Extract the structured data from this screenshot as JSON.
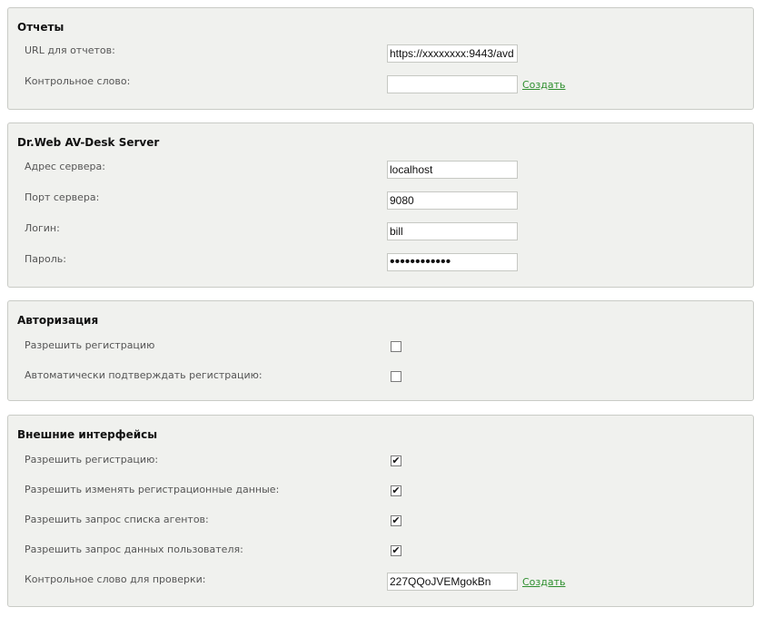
{
  "reports": {
    "title": "Отчеты",
    "url_label": "URL для отчетов:",
    "url_value": "https://xxxxxxxx:9443/avd",
    "secret_label": "Контрольное слово:",
    "secret_value": "",
    "create_link": "Создать"
  },
  "server": {
    "title": "Dr.Web AV-Desk Server",
    "address_label": "Адрес сервера:",
    "address_value": "localhost",
    "port_label": "Порт сервера:",
    "port_value": "9080",
    "login_label": "Логин:",
    "login_value": "bill",
    "password_label": "Пароль:",
    "password_value": "************"
  },
  "auth": {
    "title": "Авторизация",
    "allow_reg_label": "Разрешить регистрацию",
    "allow_reg_checked": false,
    "auto_confirm_label": "Автоматически подтверждать регистрацию:",
    "auto_confirm_checked": false
  },
  "external": {
    "title": "Внешние интерфейсы",
    "allow_reg_label": "Разрешить регистрацию:",
    "allow_reg_checked": true,
    "allow_edit_label": "Разрешить изменять регистрационные данные:",
    "allow_edit_checked": true,
    "allow_agents_label": "Разрешить запрос списка агентов:",
    "allow_agents_checked": true,
    "allow_user_label": "Разрешить запрос данных пользователя:",
    "allow_user_checked": true,
    "check_word_label": "Контрольное слово для проверки:",
    "check_word_value": "227QQoJVEMgokBn",
    "create_link": "Создать"
  },
  "checkmark_glyph": "✔"
}
